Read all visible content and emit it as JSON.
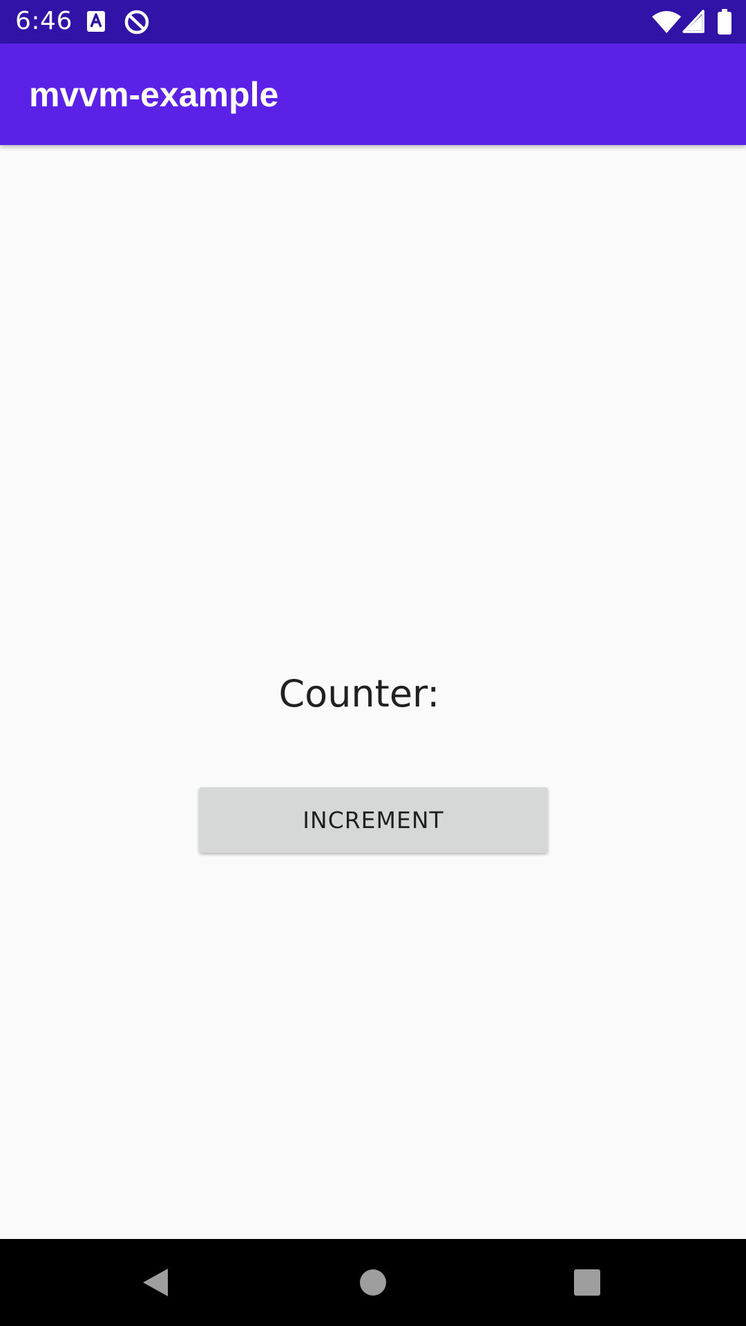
{
  "status_bar": {
    "time": "6:46",
    "background": "#3213a8",
    "icons": [
      "text-a-notification-icon",
      "data-saver-icon",
      "wifi-icon",
      "signal-icon",
      "battery-icon"
    ]
  },
  "app_bar": {
    "title": "mvvm-example",
    "background": "#5b21e6"
  },
  "main": {
    "counter_label": "Counter:",
    "increment_label": "INCREMENT"
  },
  "nav_bar": {
    "buttons": [
      "back-icon",
      "home-icon",
      "recents-icon"
    ]
  }
}
